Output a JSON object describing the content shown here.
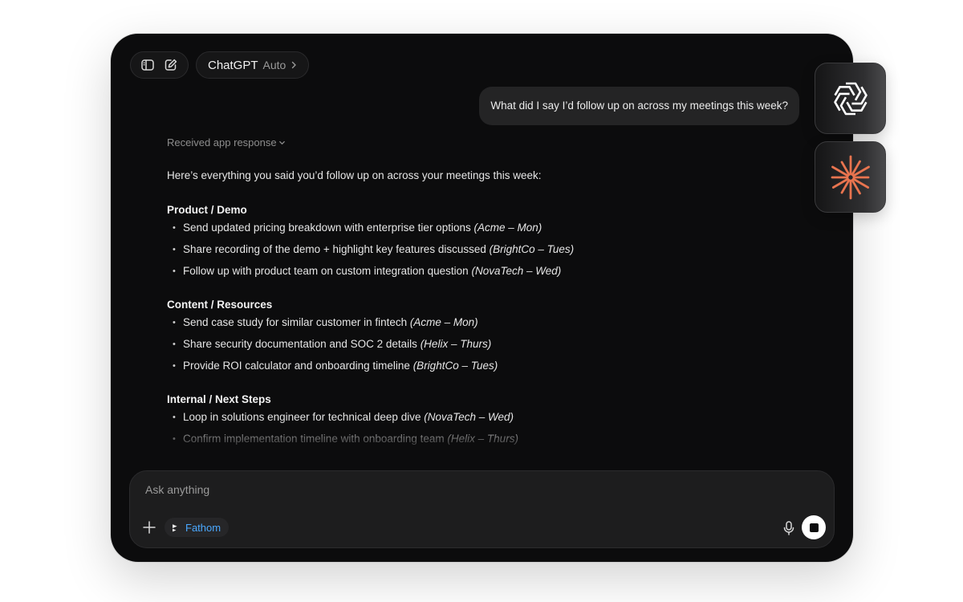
{
  "header": {
    "model_name": "ChatGPT",
    "model_mode": "Auto",
    "sidebar_icon": "sidebar-toggle-icon",
    "compose_icon": "new-chat-icon"
  },
  "user_message": "What did I say I’d follow up on across my meetings this week?",
  "response": {
    "received_label": "Received app response",
    "intro": "Here’s everything you said you’d follow up on across your meetings this week:",
    "sections": [
      {
        "title": "Product / Demo",
        "items": [
          {
            "text": "Send updated pricing breakdown with enterprise tier options",
            "meta": "(Acme – Mon)"
          },
          {
            "text": "Share recording of the demo + highlight key features discussed",
            "meta": "(BrightCo – Tues)"
          },
          {
            "text": "Follow up with product team on custom integration question",
            "meta": "(NovaTech – Wed)"
          }
        ]
      },
      {
        "title": "Content / Resources",
        "items": [
          {
            "text": "Send case study for similar customer in fintech",
            "meta": "(Acme – Mon)"
          },
          {
            "text": "Share security documentation and SOC 2 details",
            "meta": "(Helix – Thurs)"
          },
          {
            "text": "Provide ROI calculator and onboarding timeline",
            "meta": "(BrightCo – Tues)"
          }
        ]
      },
      {
        "title": "Internal / Next Steps",
        "items": [
          {
            "text": "Loop in solutions engineer for technical deep dive",
            "meta": "(NovaTech – Wed)"
          },
          {
            "text": "Confirm implementation timeline with onboarding team",
            "meta": "(Helix – Thurs)"
          }
        ]
      }
    ]
  },
  "composer": {
    "placeholder": "Ask anything",
    "app_chip_label": "Fathom"
  },
  "side_apps": [
    {
      "name": "openai-logo-icon"
    },
    {
      "name": "claude-logo-icon"
    }
  ],
  "colors": {
    "background": "#0c0c0d",
    "accent_link": "#4aa8ff",
    "claude_orange": "#e8744f"
  }
}
